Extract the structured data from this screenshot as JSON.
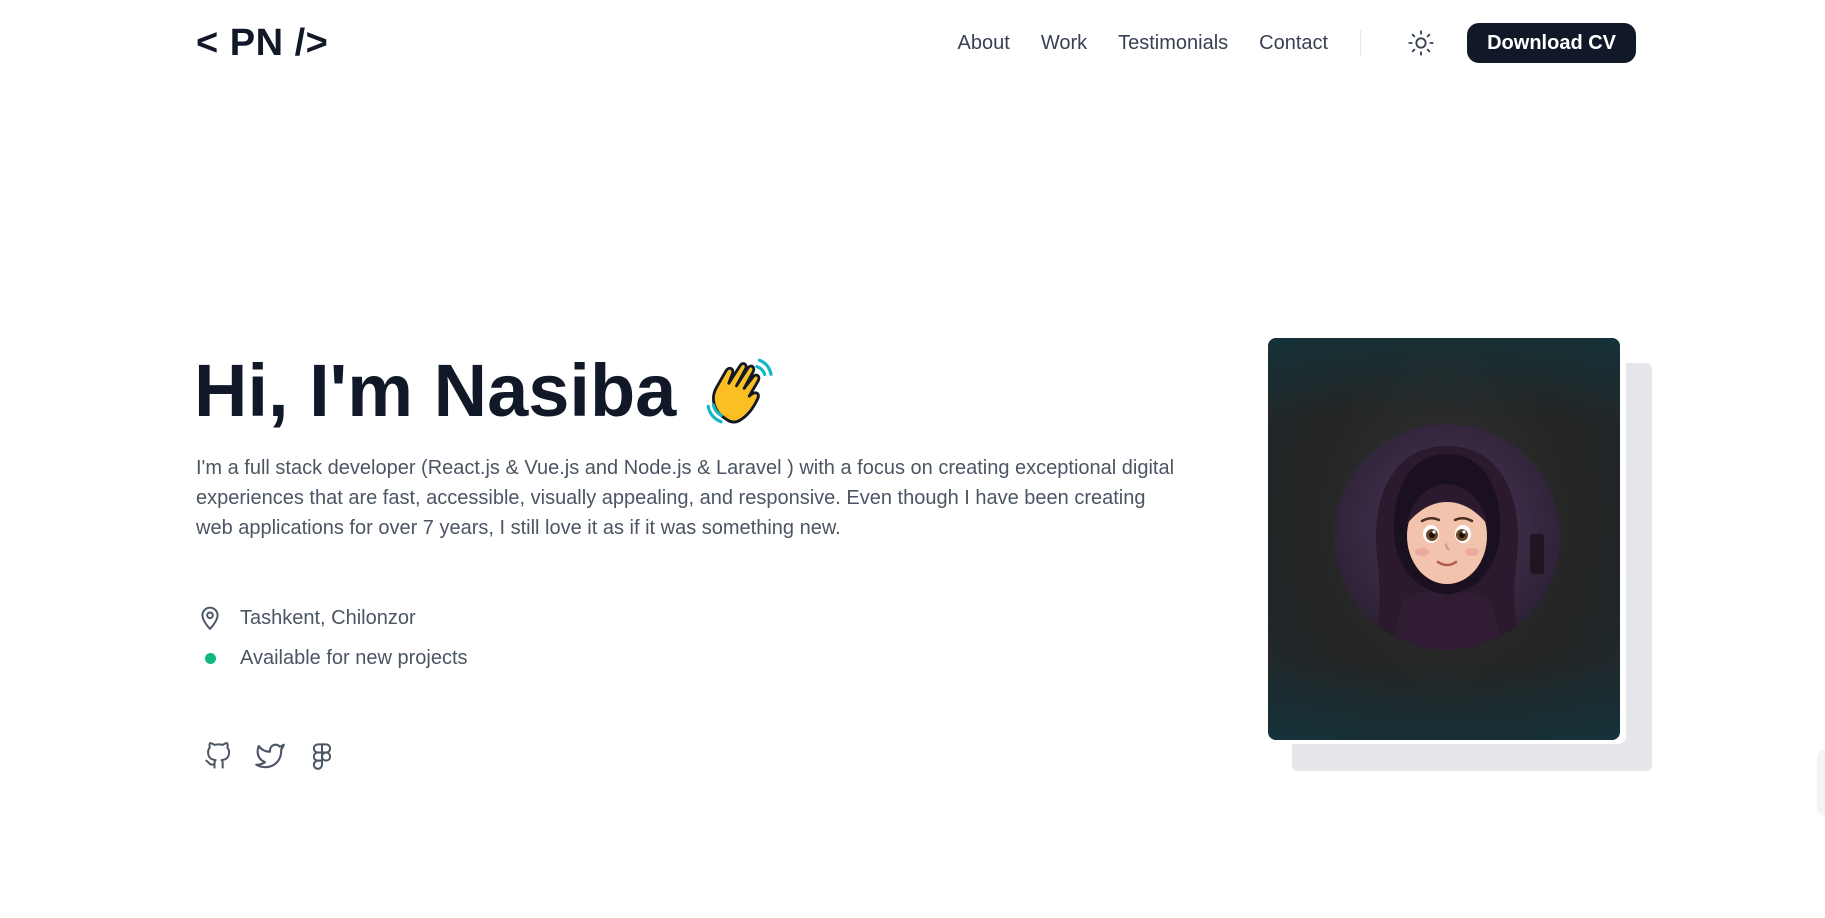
{
  "header": {
    "logo": "< PN />",
    "nav": [
      "About",
      "Work",
      "Testimonials",
      "Contact"
    ],
    "theme_icon": "sun-icon",
    "cv_button": "Download CV"
  },
  "hero": {
    "title": "Hi, I'm Nasiba",
    "emoji": "waving-hand-icon",
    "description": "I'm a full stack developer (React.js & Vue.js and Node.js & Laravel ) with a focus on creating exceptional digital experiences that are fast, accessible, visually appealing, and responsive. Even though I have been creating web applications for over 7 years, I still love it as if it was something new.",
    "location": "Tashkent, Chilonzor",
    "availability": "Available for new projects",
    "availability_color": "#10b981",
    "socials": [
      "github-icon",
      "twitter-icon",
      "figma-icon"
    ]
  },
  "colors": {
    "primary": "#111827",
    "text_muted": "#4b5563",
    "shadow_block": "#e5e7eb"
  }
}
